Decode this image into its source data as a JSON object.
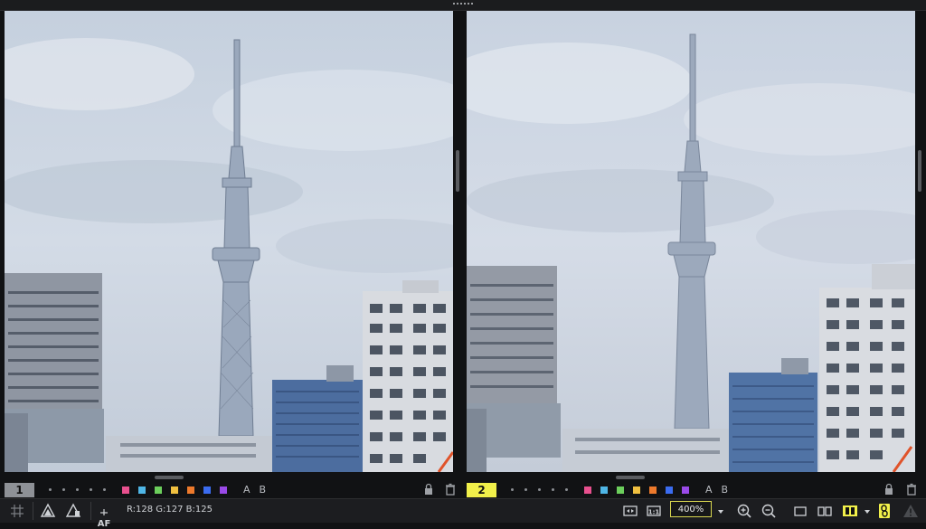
{
  "panels": [
    {
      "id": "1",
      "badge": "1",
      "active": false,
      "a_label": "A",
      "b_label": "B"
    },
    {
      "id": "2",
      "badge": "2",
      "active": true,
      "a_label": "A",
      "b_label": "B"
    }
  ],
  "color_labels": [
    "#e8508e",
    "#4fb6e6",
    "#6ccf5c",
    "#f0c040",
    "#ee7a2c",
    "#3b6cf0",
    "#9a4ae8"
  ],
  "status": {
    "rgb_readout": "R:128 G:127 B:125",
    "af_label": "AF",
    "zoom_value": "400%"
  },
  "colors": {
    "active_accent": "#f1f04a",
    "sky": "#c9d4e2",
    "building_blue": "#4a6fa5"
  }
}
